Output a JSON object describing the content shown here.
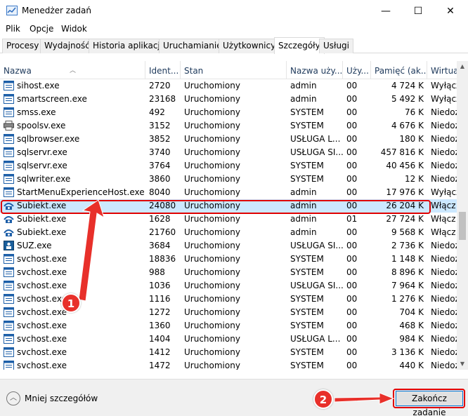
{
  "window": {
    "title": "Menedżer zadań",
    "minimize": "—",
    "maximize": "☐",
    "close": "✕"
  },
  "menu": [
    "Plik",
    "Opcje",
    "Widok"
  ],
  "tabs": [
    {
      "label": "Procesy",
      "active": false
    },
    {
      "label": "Wydajność",
      "active": false
    },
    {
      "label": "Historia aplikacji",
      "active": false
    },
    {
      "label": "Uruchamianie",
      "active": false
    },
    {
      "label": "Użytkownicy",
      "active": false
    },
    {
      "label": "Szczegóły",
      "active": true
    },
    {
      "label": "Usługi",
      "active": false
    }
  ],
  "columns": [
    "Nazwa",
    "Ident...",
    "Stan",
    "Nazwa uży...",
    "Uży...",
    "Pamięć (ak...",
    "Wirtua"
  ],
  "rows": [
    {
      "name": "sihost.exe",
      "pid": "2720",
      "status": "Uruchomiony",
      "user": "admin",
      "cpu": "00",
      "mem": "4 724 K",
      "virt": "Wyłącz",
      "icon": "app-icon"
    },
    {
      "name": "smartscreen.exe",
      "pid": "23168",
      "status": "Uruchomiony",
      "user": "admin",
      "cpu": "00",
      "mem": "5 492 K",
      "virt": "Wyłącz",
      "icon": "app-icon"
    },
    {
      "name": "smss.exe",
      "pid": "492",
      "status": "Uruchomiony",
      "user": "SYSTEM",
      "cpu": "00",
      "mem": "76 K",
      "virt": "Niedoz",
      "icon": "app-icon"
    },
    {
      "name": "spoolsv.exe",
      "pid": "3152",
      "status": "Uruchomiony",
      "user": "SYSTEM",
      "cpu": "00",
      "mem": "4 676 K",
      "virt": "Niedoz",
      "icon": "printer-icon"
    },
    {
      "name": "sqlbrowser.exe",
      "pid": "3852",
      "status": "Uruchomiony",
      "user": "USŁUGA L...",
      "cpu": "00",
      "mem": "180 K",
      "virt": "Niedoz",
      "icon": "app-icon"
    },
    {
      "name": "sqlservr.exe",
      "pid": "3740",
      "status": "Uruchomiony",
      "user": "USŁUGA SI...",
      "cpu": "00",
      "mem": "457 816 K",
      "virt": "Niedoz",
      "icon": "app-icon"
    },
    {
      "name": "sqlservr.exe",
      "pid": "3764",
      "status": "Uruchomiony",
      "user": "SYSTEM",
      "cpu": "00",
      "mem": "40 456 K",
      "virt": "Niedoz",
      "icon": "app-icon"
    },
    {
      "name": "sqlwriter.exe",
      "pid": "3860",
      "status": "Uruchomiony",
      "user": "SYSTEM",
      "cpu": "00",
      "mem": "12 K",
      "virt": "Niedoz",
      "icon": "app-icon"
    },
    {
      "name": "StartMenuExperienceHost.exe",
      "pid": "8040",
      "status": "Uruchomiony",
      "user": "admin",
      "cpu": "00",
      "mem": "17 976 K",
      "virt": "Wyłącz",
      "icon": "app-icon"
    },
    {
      "name": "Subiekt.exe",
      "pid": "24080",
      "status": "Uruchomiony",
      "user": "admin",
      "cpu": "00",
      "mem": "26 204 K",
      "virt": "Włącz",
      "icon": "subiekt-icon",
      "selected": true
    },
    {
      "name": "Subiekt.exe",
      "pid": "1628",
      "status": "Uruchomiony",
      "user": "admin",
      "cpu": "01",
      "mem": "27 724 K",
      "virt": "Włącz",
      "icon": "subiekt-icon"
    },
    {
      "name": "Subiekt.exe",
      "pid": "21760",
      "status": "Uruchomiony",
      "user": "admin",
      "cpu": "00",
      "mem": "9 568 K",
      "virt": "Włącz",
      "icon": "subiekt-icon"
    },
    {
      "name": "SUZ.exe",
      "pid": "3684",
      "status": "Uruchomiony",
      "user": "USŁUGA SI...",
      "cpu": "00",
      "mem": "2 736 K",
      "virt": "Niedoz",
      "icon": "suz-icon"
    },
    {
      "name": "svchost.exe",
      "pid": "18836",
      "status": "Uruchomiony",
      "user": "SYSTEM",
      "cpu": "00",
      "mem": "1 148 K",
      "virt": "Niedoz",
      "icon": "app-icon"
    },
    {
      "name": "svchost.exe",
      "pid": "988",
      "status": "Uruchomiony",
      "user": "SYSTEM",
      "cpu": "00",
      "mem": "8 896 K",
      "virt": "Niedoz",
      "icon": "app-icon"
    },
    {
      "name": "svchost.exe",
      "pid": "1036",
      "status": "Uruchomiony",
      "user": "USŁUGA SI...",
      "cpu": "00",
      "mem": "7 964 K",
      "virt": "Niedoz",
      "icon": "app-icon"
    },
    {
      "name": "svchost.exe",
      "pid": "1116",
      "status": "Uruchomiony",
      "user": "SYSTEM",
      "cpu": "00",
      "mem": "1 276 K",
      "virt": "Niedoz",
      "icon": "app-icon"
    },
    {
      "name": "svchost.exe",
      "pid": "1272",
      "status": "Uruchomiony",
      "user": "SYSTEM",
      "cpu": "00",
      "mem": "704 K",
      "virt": "Niedoz",
      "icon": "app-icon"
    },
    {
      "name": "svchost.exe",
      "pid": "1360",
      "status": "Uruchomiony",
      "user": "SYSTEM",
      "cpu": "00",
      "mem": "468 K",
      "virt": "Niedoz",
      "icon": "app-icon"
    },
    {
      "name": "svchost.exe",
      "pid": "1404",
      "status": "Uruchomiony",
      "user": "USŁUGA L...",
      "cpu": "00",
      "mem": "984 K",
      "virt": "Niedoz",
      "icon": "app-icon"
    },
    {
      "name": "svchost.exe",
      "pid": "1412",
      "status": "Uruchomiony",
      "user": "SYSTEM",
      "cpu": "00",
      "mem": "3 136 K",
      "virt": "Niedoz",
      "icon": "app-icon"
    },
    {
      "name": "svchost.exe",
      "pid": "1472",
      "status": "Uruchomiony",
      "user": "SYSTEM",
      "cpu": "00",
      "mem": "440 K",
      "virt": "Niedoz",
      "icon": "app-icon"
    }
  ],
  "footer": {
    "fewer_details": "Mniej szczegółów",
    "end_task": "Zakończ zadanie"
  },
  "annotations": {
    "badge1": "1",
    "badge2": "2",
    "accent_color": "#e8302a"
  }
}
